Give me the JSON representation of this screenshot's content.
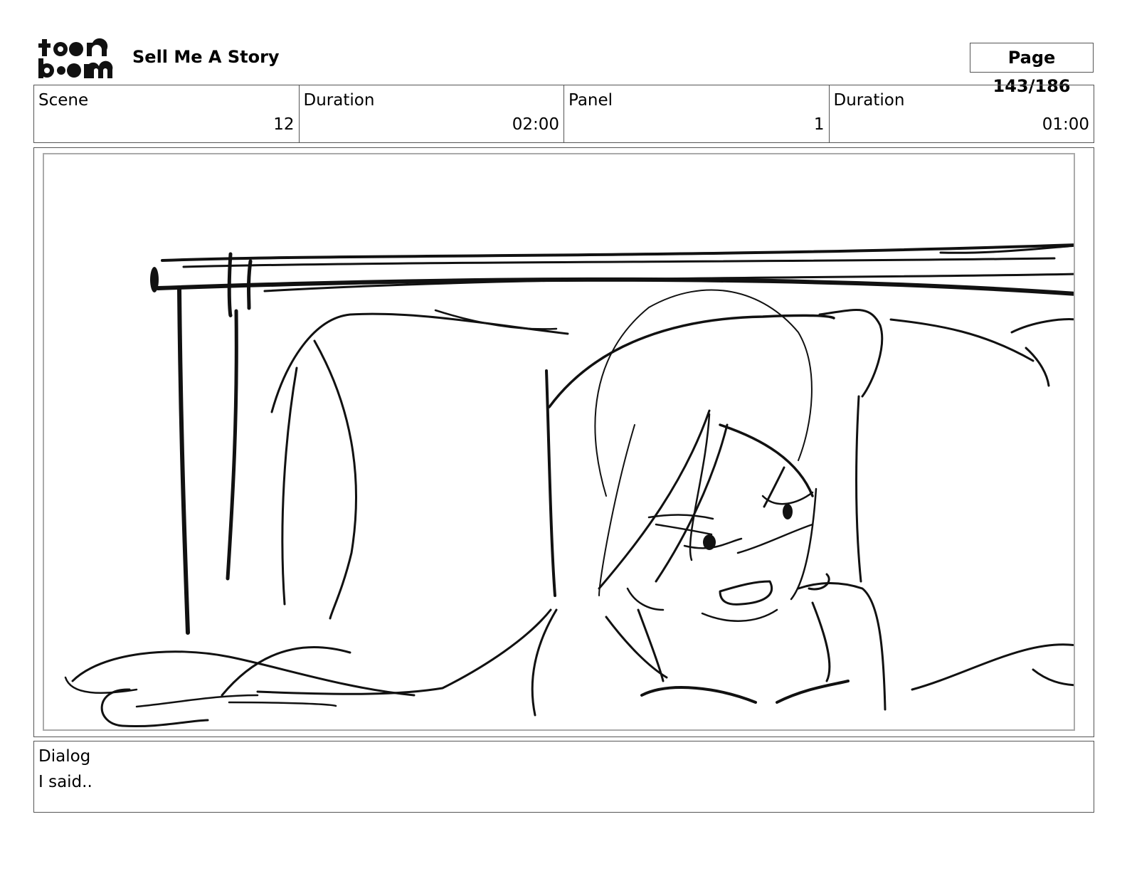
{
  "header": {
    "logo_text": "toonboom",
    "project_title": "Sell Me A Story",
    "page_label": "Page 143/186"
  },
  "info_bar": {
    "scene_label": "Scene",
    "scene_value": "12",
    "scene_duration_label": "Duration",
    "scene_duration_value": "02:00",
    "panel_label": "Panel",
    "panel_value": "1",
    "panel_duration_label": "Duration",
    "panel_duration_value": "01:00"
  },
  "panel": {
    "image_name": "storyboard-sketch"
  },
  "dialog": {
    "label": "Dialog",
    "text": "I said.."
  }
}
